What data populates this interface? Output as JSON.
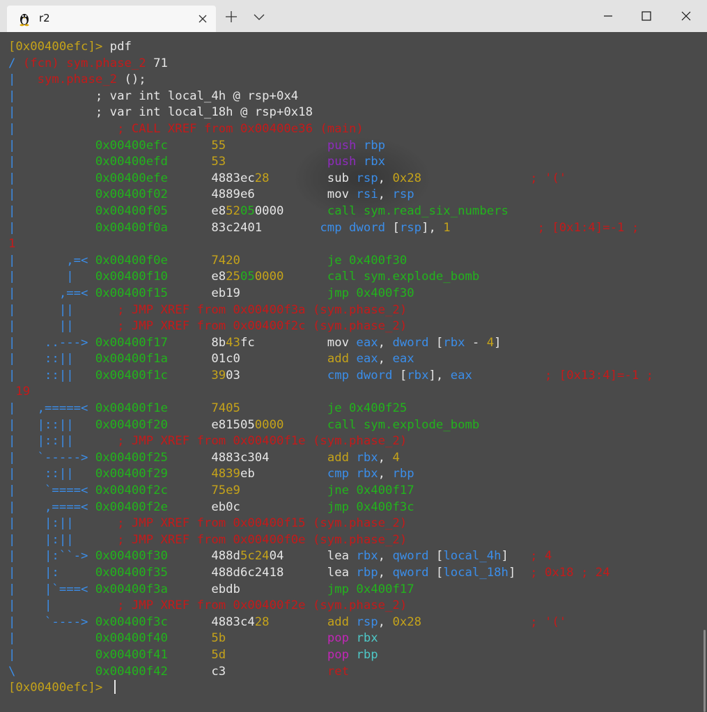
{
  "titlebar": {
    "tab_title": "r2",
    "tab_icon": "linux-tux-icon",
    "close_icon": "close-icon",
    "new_tab_icon": "plus-icon",
    "dropdown_icon": "chevron-down-icon",
    "minimize_icon": "minimize-icon",
    "maximize_icon": "maximize-icon",
    "window_close_icon": "window-close-icon"
  },
  "colors": {
    "background": "#4a4a4a",
    "yellow": "#c5a31a",
    "green": "#22b31c",
    "red": "#c41a1a",
    "blue": "#3b8eea",
    "purple": "#8e2bbd",
    "magenta": "#c226b7",
    "cyan": "#4ec9c8",
    "white": "#e6e6e6"
  },
  "terminal": {
    "prompt_text": "[0x00400efc]>",
    "prompt_cursor": true,
    "lines": [
      [
        [
          "y",
          "[0x00400efc]> "
        ],
        [
          "w",
          "pdf"
        ]
      ],
      [
        [
          "b",
          "/ "
        ],
        [
          "r",
          "(fcn) sym.phase_2"
        ],
        [
          "w",
          " 71"
        ]
      ],
      [
        [
          "b",
          "|   "
        ],
        [
          "r",
          "sym.phase_2"
        ],
        [
          "w",
          " ();"
        ]
      ],
      [
        [
          "b",
          "|           "
        ],
        [
          "w",
          "; var int local_4h @ rsp+0x4"
        ]
      ],
      [
        [
          "b",
          "|           "
        ],
        [
          "w",
          "; var int local_18h @ rsp+0x18"
        ]
      ],
      [
        [
          "b",
          "|              "
        ],
        [
          "r",
          "; CALL XREF from 0x00400e36 (main)"
        ]
      ],
      [
        [
          "b",
          "|           "
        ],
        [
          "g",
          "0x00400efc"
        ],
        [
          "w",
          "      "
        ],
        [
          "y",
          "55"
        ],
        [
          "w",
          "              "
        ],
        [
          "p",
          "push"
        ],
        [
          "w",
          " "
        ],
        [
          "b",
          "rbp"
        ]
      ],
      [
        [
          "b",
          "|           "
        ],
        [
          "g",
          "0x00400efd"
        ],
        [
          "w",
          "      "
        ],
        [
          "y",
          "53"
        ],
        [
          "w",
          "              "
        ],
        [
          "p",
          "push"
        ],
        [
          "w",
          " "
        ],
        [
          "b",
          "rbx"
        ]
      ],
      [
        [
          "b",
          "|           "
        ],
        [
          "g",
          "0x00400efe"
        ],
        [
          "w",
          "      4883ec"
        ],
        [
          "y",
          "28"
        ],
        [
          "w",
          "        sub "
        ],
        [
          "b",
          "rsp"
        ],
        [
          "w",
          ", "
        ],
        [
          "y",
          "0x28"
        ],
        [
          "w",
          "               "
        ],
        [
          "r",
          "; '('"
        ]
      ],
      [
        [
          "b",
          "|           "
        ],
        [
          "g",
          "0x00400f02"
        ],
        [
          "w",
          "      4889e6          mov "
        ],
        [
          "b",
          "rsi"
        ],
        [
          "w",
          ", "
        ],
        [
          "b",
          "rsp"
        ]
      ],
      [
        [
          "b",
          "|           "
        ],
        [
          "g",
          "0x00400f05"
        ],
        [
          "w",
          "      e8"
        ],
        [
          "y",
          "52"
        ],
        [
          "g",
          "05"
        ],
        [
          "w",
          "0000"
        ],
        [
          "w",
          "      "
        ],
        [
          "g",
          "call sym.read_six_numbers"
        ]
      ],
      [
        [
          "b",
          "|           "
        ],
        [
          "g",
          "0x00400f0a"
        ],
        [
          "w",
          "      83c24"
        ],
        [
          "w",
          "01"
        ],
        [
          "w",
          "        "
        ],
        [
          "b",
          "cmp dword "
        ],
        [
          "w",
          "["
        ],
        [
          "b",
          "rsp"
        ],
        [
          "w",
          "], "
        ],
        [
          "y",
          "1"
        ],
        [
          "w",
          "            "
        ],
        [
          "r",
          "; [0x1:4]=-1 ;"
        ]
      ],
      [
        [
          "r",
          "1"
        ]
      ],
      [
        [
          "b",
          "|       ,=< "
        ],
        [
          "g",
          "0x00400f0e"
        ],
        [
          "w",
          "      "
        ],
        [
          "y",
          "7420"
        ],
        [
          "w",
          "            "
        ],
        [
          "g",
          "je 0x400f30"
        ]
      ],
      [
        [
          "b",
          "|       |   "
        ],
        [
          "g",
          "0x00400f10"
        ],
        [
          "w",
          "      e8"
        ],
        [
          "y",
          "25"
        ],
        [
          "g",
          "05"
        ],
        [
          "y",
          "0000"
        ],
        [
          "w",
          "      "
        ],
        [
          "g",
          "call sym.explode_bomb"
        ]
      ],
      [
        [
          "b",
          "|      ,==< "
        ],
        [
          "g",
          "0x00400f15"
        ],
        [
          "w",
          "      eb19            "
        ],
        [
          "g",
          "jmp 0x400f30"
        ]
      ],
      [
        [
          "b",
          "|      ||      "
        ],
        [
          "r",
          "; JMP XREF from 0x00400f3a (sym.phase_2)"
        ]
      ],
      [
        [
          "b",
          "|      ||      "
        ],
        [
          "r",
          "; JMP XREF from 0x00400f2c (sym.phase_2)"
        ]
      ],
      [
        [
          "b",
          "|    ..---> "
        ],
        [
          "g",
          "0x00400f17"
        ],
        [
          "w",
          "      8b"
        ],
        [
          "y",
          "43"
        ],
        [
          "w",
          "fc          mov "
        ],
        [
          "b",
          "eax"
        ],
        [
          "w",
          ", "
        ],
        [
          "b",
          "dword "
        ],
        [
          "w",
          "["
        ],
        [
          "b",
          "rbx"
        ],
        [
          "w",
          " - "
        ],
        [
          "y",
          "4"
        ],
        [
          "w",
          "]"
        ]
      ],
      [
        [
          "b",
          "|    ::||   "
        ],
        [
          "g",
          "0x00400f1a"
        ],
        [
          "w",
          "      01c0            "
        ],
        [
          "y",
          "add"
        ],
        [
          "w",
          " "
        ],
        [
          "b",
          "eax"
        ],
        [
          "w",
          ", "
        ],
        [
          "b",
          "eax"
        ]
      ],
      [
        [
          "b",
          "|    ::||   "
        ],
        [
          "g",
          "0x00400f1c"
        ],
        [
          "w",
          "      "
        ],
        [
          "y",
          "39"
        ],
        [
          "w",
          "03            "
        ],
        [
          "b",
          "cmp dword "
        ],
        [
          "w",
          "["
        ],
        [
          "b",
          "rbx"
        ],
        [
          "w",
          "], "
        ],
        [
          "b",
          "eax"
        ],
        [
          "w",
          "          "
        ],
        [
          "r",
          "; [0x13:4]=-1 ;"
        ]
      ],
      [
        [
          "r",
          " 19"
        ]
      ],
      [
        [
          "b",
          "|   ,=====< "
        ],
        [
          "g",
          "0x00400f1e"
        ],
        [
          "w",
          "      "
        ],
        [
          "y",
          "7405"
        ],
        [
          "w",
          "            "
        ],
        [
          "g",
          "je 0x400f25"
        ]
      ],
      [
        [
          "b",
          "|   |::||   "
        ],
        [
          "g",
          "0x00400f20"
        ],
        [
          "w",
          "      e81505"
        ],
        [
          "y",
          "0000"
        ],
        [
          "w",
          "      "
        ],
        [
          "g",
          "call sym.explode_bomb"
        ]
      ],
      [
        [
          "b",
          "|   |::||      "
        ],
        [
          "r",
          "; JMP XREF from 0x00400f1e (sym.phase_2)"
        ]
      ],
      [
        [
          "b",
          "|   `-----> "
        ],
        [
          "g",
          "0x00400f25"
        ],
        [
          "w",
          "      4883c304        "
        ],
        [
          "y",
          "add"
        ],
        [
          "w",
          " "
        ],
        [
          "b",
          "rbx"
        ],
        [
          "w",
          ", "
        ],
        [
          "y",
          "4"
        ]
      ],
      [
        [
          "b",
          "|    ::||   "
        ],
        [
          "g",
          "0x00400f29"
        ],
        [
          "w",
          "      "
        ],
        [
          "y",
          "4839"
        ],
        [
          "w",
          "eb          "
        ],
        [
          "b",
          "cmp rbx"
        ],
        [
          "w",
          ", "
        ],
        [
          "b",
          "rbp"
        ]
      ],
      [
        [
          "b",
          "|    `====< "
        ],
        [
          "g",
          "0x00400f2c"
        ],
        [
          "w",
          "      "
        ],
        [
          "y",
          "75e9"
        ],
        [
          "w",
          "            "
        ],
        [
          "g",
          "jne 0x400f17"
        ]
      ],
      [
        [
          "b",
          "|    ,====< "
        ],
        [
          "g",
          "0x00400f2e"
        ],
        [
          "w",
          "      eb0c            "
        ],
        [
          "g",
          "jmp 0x400f3c"
        ]
      ],
      [
        [
          "b",
          "|    |:||      "
        ],
        [
          "r",
          "; JMP XREF from 0x00400f15 (sym.phase_2)"
        ]
      ],
      [
        [
          "b",
          "|    |:||      "
        ],
        [
          "r",
          "; JMP XREF from 0x00400f0e (sym.phase_2)"
        ]
      ],
      [
        [
          "b",
          "|    |:``-> "
        ],
        [
          "g",
          "0x00400f30"
        ],
        [
          "w",
          "      488d"
        ],
        [
          "y",
          "5c24"
        ],
        [
          "w",
          "04      lea "
        ],
        [
          "b",
          "rbx"
        ],
        [
          "w",
          ", "
        ],
        [
          "b",
          "qword "
        ],
        [
          "w",
          "["
        ],
        [
          "b",
          "local_4h"
        ],
        [
          "w",
          "]   "
        ],
        [
          "r",
          "; 4"
        ]
      ],
      [
        [
          "b",
          "|    |:     "
        ],
        [
          "g",
          "0x00400f35"
        ],
        [
          "w",
          "      488d6c2418      lea "
        ],
        [
          "b",
          "rbp"
        ],
        [
          "w",
          ", "
        ],
        [
          "b",
          "qword "
        ],
        [
          "w",
          "["
        ],
        [
          "b",
          "local_18h"
        ],
        [
          "w",
          "]  "
        ],
        [
          "r",
          "; 0x18 ; 24"
        ]
      ],
      [
        [
          "b",
          "|    |`===< "
        ],
        [
          "g",
          "0x00400f3a"
        ],
        [
          "w",
          "      ebdb            "
        ],
        [
          "g",
          "jmp 0x400f17"
        ]
      ],
      [
        [
          "b",
          "|    |         "
        ],
        [
          "r",
          "; JMP XREF from 0x00400f2e (sym.phase_2)"
        ]
      ],
      [
        [
          "b",
          "|    `----> "
        ],
        [
          "g",
          "0x00400f3c"
        ],
        [
          "w",
          "      4883c4"
        ],
        [
          "y",
          "28"
        ],
        [
          "w",
          "        "
        ],
        [
          "y",
          "add"
        ],
        [
          "w",
          " "
        ],
        [
          "b",
          "rsp"
        ],
        [
          "w",
          ", "
        ],
        [
          "y",
          "0x28"
        ],
        [
          "w",
          "               "
        ],
        [
          "r",
          "; '('"
        ]
      ],
      [
        [
          "b",
          "|           "
        ],
        [
          "g",
          "0x00400f40"
        ],
        [
          "w",
          "      "
        ],
        [
          "y",
          "5b"
        ],
        [
          "w",
          "              "
        ],
        [
          "m",
          "pop"
        ],
        [
          "w",
          " "
        ],
        [
          "c",
          "rbx"
        ]
      ],
      [
        [
          "b",
          "|           "
        ],
        [
          "g",
          "0x00400f41"
        ],
        [
          "w",
          "      "
        ],
        [
          "y",
          "5d"
        ],
        [
          "w",
          "              "
        ],
        [
          "m",
          "pop"
        ],
        [
          "w",
          " "
        ],
        [
          "c",
          "rbp"
        ]
      ],
      [
        [
          "b",
          "\\           "
        ],
        [
          "g",
          "0x00400f42"
        ],
        [
          "w",
          "      c3              "
        ],
        [
          "r",
          "ret"
        ]
      ],
      [
        [
          "y",
          "[0x00400efc]> "
        ]
      ]
    ]
  }
}
